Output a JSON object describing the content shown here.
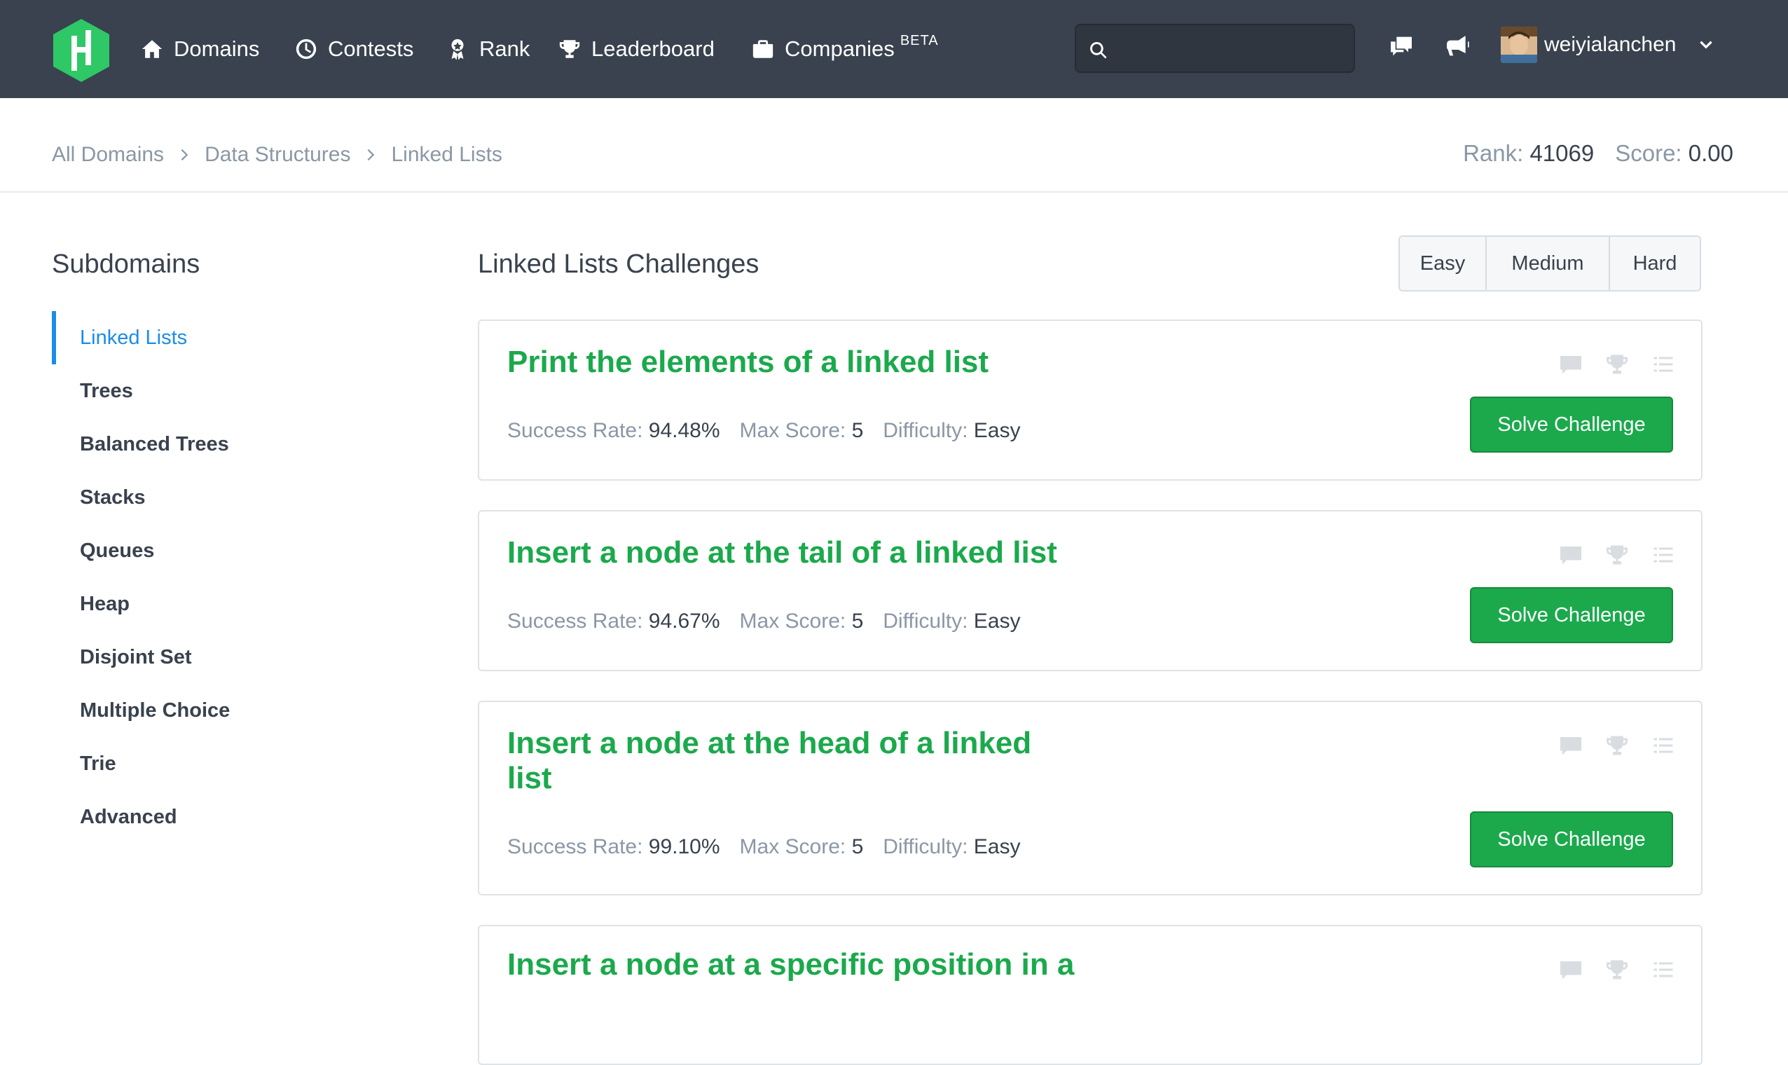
{
  "nav": {
    "items": [
      {
        "label": "Domains",
        "icon": "home-icon"
      },
      {
        "label": "Contests",
        "icon": "clock-icon"
      },
      {
        "label": "Rank",
        "icon": "medal-icon"
      },
      {
        "label": "Leaderboard",
        "icon": "trophy-icon"
      },
      {
        "label": "Companies",
        "icon": "briefcase-icon",
        "badge": "BETA"
      }
    ],
    "search_placeholder": "",
    "username": "weiyialanchen"
  },
  "breadcrumb": [
    "All Domains",
    "Data Structures",
    "Linked Lists"
  ],
  "stats": {
    "rank_label": "Rank:",
    "rank": "41069",
    "score_label": "Score:",
    "score": "0.00"
  },
  "sidebar": {
    "title": "Subdomains",
    "items": [
      "Linked Lists",
      "Trees",
      "Balanced Trees",
      "Stacks",
      "Queues",
      "Heap",
      "Disjoint Set",
      "Multiple Choice",
      "Trie",
      "Advanced"
    ]
  },
  "main": {
    "title": "Linked Lists Challenges",
    "filters": [
      "Easy",
      "Medium",
      "Hard"
    ],
    "labels": {
      "success_rate": "Success Rate:",
      "max_score": "Max Score:",
      "difficulty": "Difficulty:",
      "solve": "Solve Challenge"
    },
    "challenges": [
      {
        "title": "Print the elements of a linked list",
        "success_rate": "94.48%",
        "max_score": "5",
        "difficulty": "Easy"
      },
      {
        "title": "Insert a node at the tail of a linked list",
        "success_rate": "94.67%",
        "max_score": "5",
        "difficulty": "Easy"
      },
      {
        "title": "Insert a node at the head of a linked list",
        "success_rate": "99.10%",
        "max_score": "5",
        "difficulty": "Easy"
      },
      {
        "title": "Insert a node at a specific position in a"
      }
    ]
  },
  "colors": {
    "nav_bg": "#39424e",
    "accent_green": "#1ba94c",
    "active_blue": "#1c8ce8",
    "logo_green": "#2ec866"
  }
}
